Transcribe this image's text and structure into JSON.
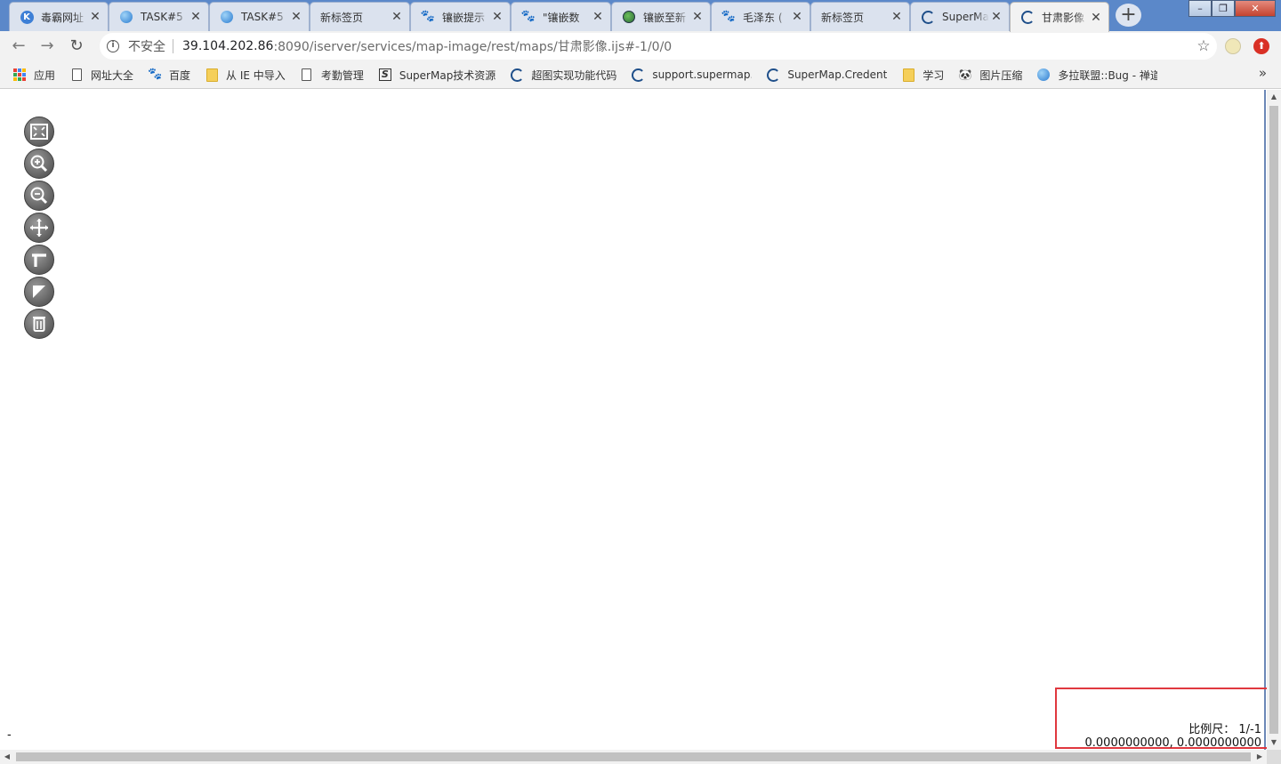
{
  "tabs": [
    {
      "title": "毒霸网址",
      "icon": "kingsoft-icon",
      "active": false
    },
    {
      "title": "TASK#5",
      "icon": "globe-icon",
      "active": false
    },
    {
      "title": "TASK#5",
      "icon": "globe-icon",
      "active": false
    },
    {
      "title": "新标签页",
      "icon": "",
      "active": false
    },
    {
      "title": "镶嵌提示",
      "icon": "baidu-paw-icon",
      "active": false
    },
    {
      "title": "\"镶嵌数",
      "icon": "baidu-paw-icon",
      "active": false
    },
    {
      "title": "镶嵌至新",
      "icon": "earth-icon",
      "active": false
    },
    {
      "title": "毛泽东 (",
      "icon": "baidu-paw-icon",
      "active": false
    },
    {
      "title": "新标签页",
      "icon": "",
      "active": false
    },
    {
      "title": "SuperMa",
      "icon": "supermap-icon",
      "active": false
    },
    {
      "title": "甘肃影像",
      "icon": "supermap-icon",
      "active": true
    }
  ],
  "toolbar": {
    "security_label": "不安全",
    "url_host": "39.104.202.86",
    "url_path": ":8090/iserver/services/map-image/rest/maps/甘肃影像.ijs#-1/0/0"
  },
  "bookmarks": [
    {
      "label": "应用",
      "icon": "apps-grid-icon"
    },
    {
      "label": "网址大全",
      "icon": "page-icon"
    },
    {
      "label": "百度",
      "icon": "baidu-paw-icon"
    },
    {
      "label": "从 IE 中导入",
      "icon": "folder-icon"
    },
    {
      "label": "考勤管理",
      "icon": "page-icon"
    },
    {
      "label": "SuperMap技术资源",
      "icon": "supermap-s-icon"
    },
    {
      "label": "超图实现功能代码",
      "icon": "supermap-icon"
    },
    {
      "label": "support.supermap.c",
      "icon": "supermap-icon"
    },
    {
      "label": "SuperMap.Credenti",
      "icon": "supermap-icon"
    },
    {
      "label": "学习",
      "icon": "folder-icon"
    },
    {
      "label": "图片压缩",
      "icon": "panda-icon"
    },
    {
      "label": "多拉联盟::Bug - 禅道",
      "icon": "globe-icon"
    }
  ],
  "map": {
    "tools": [
      "full-extent",
      "zoom-in",
      "zoom-out",
      "pan",
      "measure-distance",
      "measure-area",
      "clear"
    ],
    "scale_label": "比例尺：",
    "scale_value": "1/-1",
    "coordinates": "0.0000000000, 0.0000000000",
    "dash": "-"
  },
  "colors": {
    "tabstrip": "#5b88c9",
    "highlight_box": "#e0383f"
  }
}
